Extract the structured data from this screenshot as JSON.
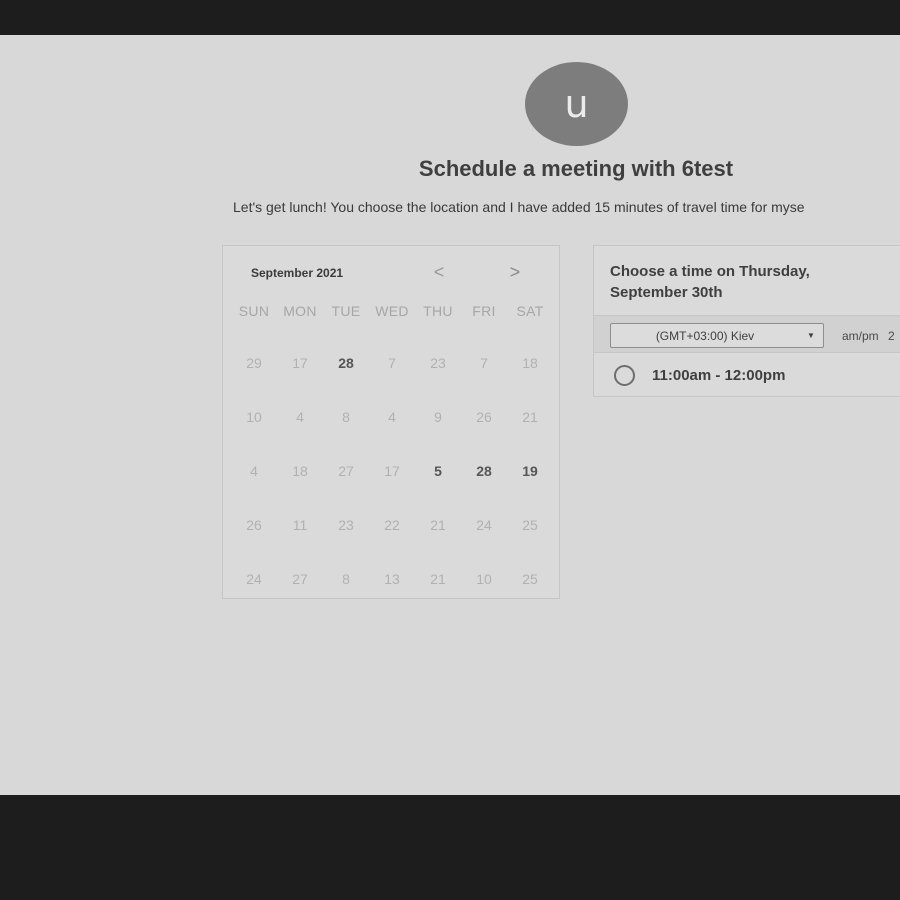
{
  "avatar": {
    "letter": "u"
  },
  "header": {
    "title": "Schedule a meeting with 6test",
    "description": "Let's get lunch! You choose the location and I have added 15 minutes of travel time for myse"
  },
  "calendar": {
    "month_label": "September 2021",
    "prev_icon": "chevron-left-icon",
    "next_icon": "chevron-right-icon",
    "prev_glyph": "<",
    "next_glyph": ">",
    "weekdays": [
      "SUN",
      "MON",
      "TUE",
      "WED",
      "THU",
      "FRI",
      "SAT"
    ],
    "weeks": [
      [
        {
          "d": "29",
          "a": false
        },
        {
          "d": "17",
          "a": false
        },
        {
          "d": "28",
          "a": true
        },
        {
          "d": "7",
          "a": false
        },
        {
          "d": "23",
          "a": false
        },
        {
          "d": "7",
          "a": false
        },
        {
          "d": "18",
          "a": false
        }
      ],
      [
        {
          "d": "10",
          "a": false
        },
        {
          "d": "4",
          "a": false
        },
        {
          "d": "8",
          "a": false
        },
        {
          "d": "4",
          "a": false
        },
        {
          "d": "9",
          "a": false
        },
        {
          "d": "26",
          "a": false
        },
        {
          "d": "21",
          "a": false
        }
      ],
      [
        {
          "d": "4",
          "a": false
        },
        {
          "d": "18",
          "a": false
        },
        {
          "d": "27",
          "a": false
        },
        {
          "d": "17",
          "a": false
        },
        {
          "d": "5",
          "a": true
        },
        {
          "d": "28",
          "a": true
        },
        {
          "d": "19",
          "a": true
        }
      ],
      [
        {
          "d": "26",
          "a": false
        },
        {
          "d": "11",
          "a": false
        },
        {
          "d": "23",
          "a": false
        },
        {
          "d": "22",
          "a": false
        },
        {
          "d": "21",
          "a": false
        },
        {
          "d": "24",
          "a": false
        },
        {
          "d": "25",
          "a": false
        }
      ],
      [
        {
          "d": "24",
          "a": false
        },
        {
          "d": "27",
          "a": false
        },
        {
          "d": "8",
          "a": false
        },
        {
          "d": "13",
          "a": false
        },
        {
          "d": "21",
          "a": false
        },
        {
          "d": "10",
          "a": false
        },
        {
          "d": "25",
          "a": false
        }
      ]
    ]
  },
  "time_panel": {
    "heading_line1": "Choose a time on Thursday,",
    "heading_line2": "September 30th",
    "timezone": "(GMT+03:00) Kiev",
    "format_label": "am/pm",
    "format_extra": "2",
    "slots": [
      {
        "label": "11:00am - 12:00pm"
      }
    ]
  },
  "colors": {
    "page_bg": "#d8d8d8",
    "frame_bg": "#1d1d1d",
    "avatar_bg": "#7d7d7d"
  }
}
